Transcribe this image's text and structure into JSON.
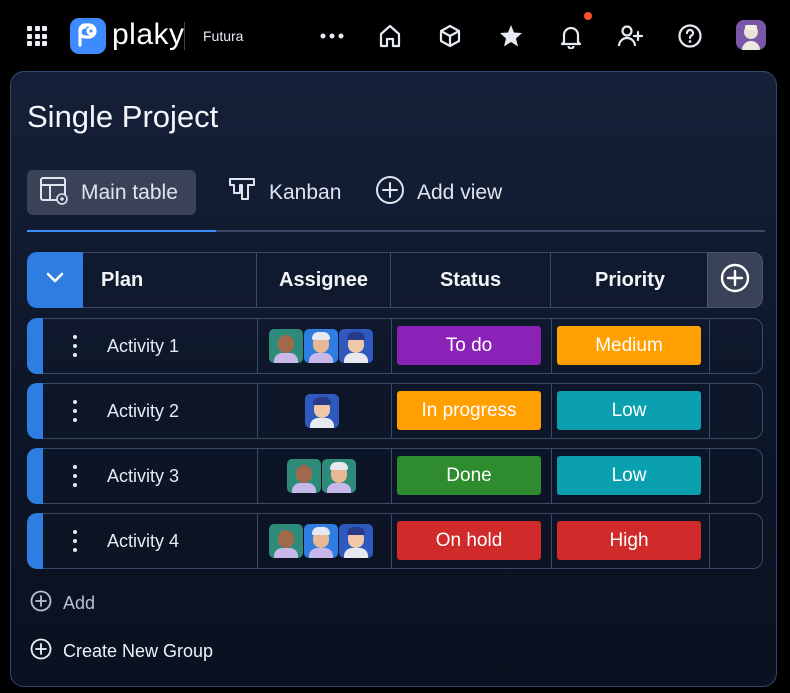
{
  "topbar": {
    "logo_text": "plaky",
    "workspace": "Futura",
    "icons": [
      "apps-grid-icon",
      "more-icon",
      "home-icon",
      "box-icon",
      "star-icon",
      "bell-icon",
      "add-user-icon",
      "help-icon"
    ],
    "notification_dot_color": "#ff4d2e"
  },
  "page": {
    "title": "Single Project"
  },
  "tabs": [
    {
      "label": "Main table",
      "icon": "table-icon",
      "active": true
    },
    {
      "label": "Kanban",
      "icon": "kanban-icon",
      "active": false
    },
    {
      "label": "Add view",
      "icon": "plus-circle-icon",
      "active": false
    }
  ],
  "table": {
    "columns": [
      "Plan",
      "Assignee",
      "Status",
      "Priority"
    ],
    "rows": [
      {
        "name": "Activity 1",
        "assignees": 3,
        "status": "To do",
        "status_color": "#8b22b8",
        "priority": "Medium",
        "priority_color": "#ff9f00"
      },
      {
        "name": "Activity 2",
        "assignees": 1,
        "status": "In progress",
        "status_color": "#ff9f00",
        "priority": "Low",
        "priority_color": "#0aa0b0"
      },
      {
        "name": "Activity 3",
        "assignees": 2,
        "status": "Done",
        "status_color": "#2e8b2e",
        "priority": "Low",
        "priority_color": "#0aa0b0"
      },
      {
        "name": "Activity 4",
        "assignees": 3,
        "status": "On hold",
        "status_color": "#d02a2a",
        "priority": "High",
        "priority_color": "#d02a2a"
      }
    ],
    "add_label": "Add",
    "create_group_label": "Create New Group"
  },
  "colors": {
    "accent": "#2e7de0",
    "brand": "#3d8bff"
  }
}
